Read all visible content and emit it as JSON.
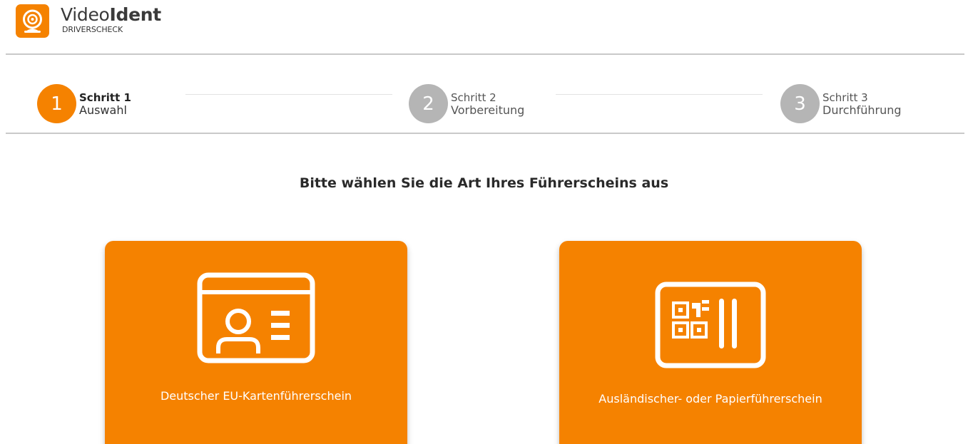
{
  "header": {
    "brand_light": "Video",
    "brand_bold": "Ident",
    "brand_sub": "DRIVERSCHECK",
    "logo_icon": "webcam-icon"
  },
  "stepper": {
    "steps": [
      {
        "number": "1",
        "title": "Schritt 1",
        "subtitle": "Auswahl",
        "state": "active"
      },
      {
        "number": "2",
        "title": "Schritt 2",
        "subtitle": "Vorbereitung",
        "state": "inactive"
      },
      {
        "number": "3",
        "title": "Schritt 3",
        "subtitle": "Durchführung",
        "state": "inactive"
      }
    ]
  },
  "main": {
    "question": "Bitte wählen Sie die Art Ihres Führerscheins aus",
    "options": [
      {
        "label": "Deutscher EU-Kartenführerschein",
        "icon": "id-card-icon"
      },
      {
        "label": "Ausländischer- oder Papierführerschein",
        "icon": "qr-document-icon"
      }
    ]
  },
  "colors": {
    "accent": "#f58200",
    "inactive_step": "#b5b5b5",
    "divider": "#c9c9c9"
  }
}
